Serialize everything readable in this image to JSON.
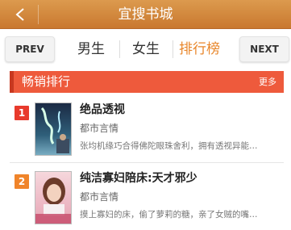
{
  "header": {
    "title": "宜搜书城",
    "back_icon": "chevron-left-icon",
    "background_color": "#d28a3e"
  },
  "tabs": {
    "prev_label": "PREV",
    "next_label": "NEXT",
    "items": [
      {
        "label": "男生",
        "active": false
      },
      {
        "label": "女生",
        "active": false
      },
      {
        "label": "排行榜",
        "active": true
      }
    ],
    "active_color": "#e8862a"
  },
  "section": {
    "title": "畅销排行",
    "more_label": "更多",
    "color": "#ee5a3c"
  },
  "books": [
    {
      "rank": "1",
      "rank_color": "#e83a2c",
      "title": "绝品透视",
      "category": "都市言情",
      "description": "张均机缘巧合得佛陀眼珠舍利，拥有透视异能…",
      "cover_text": "绝品透视"
    },
    {
      "rank": "2",
      "rank_color": "#f0842a",
      "title": "纯洁寡妇陪床:天才邪少",
      "category": "都市言情",
      "description": "摸上寡妇的床，偷了萝莉的糖，亲了女贼的嘴…",
      "cover_text": "天才邪少"
    }
  ]
}
